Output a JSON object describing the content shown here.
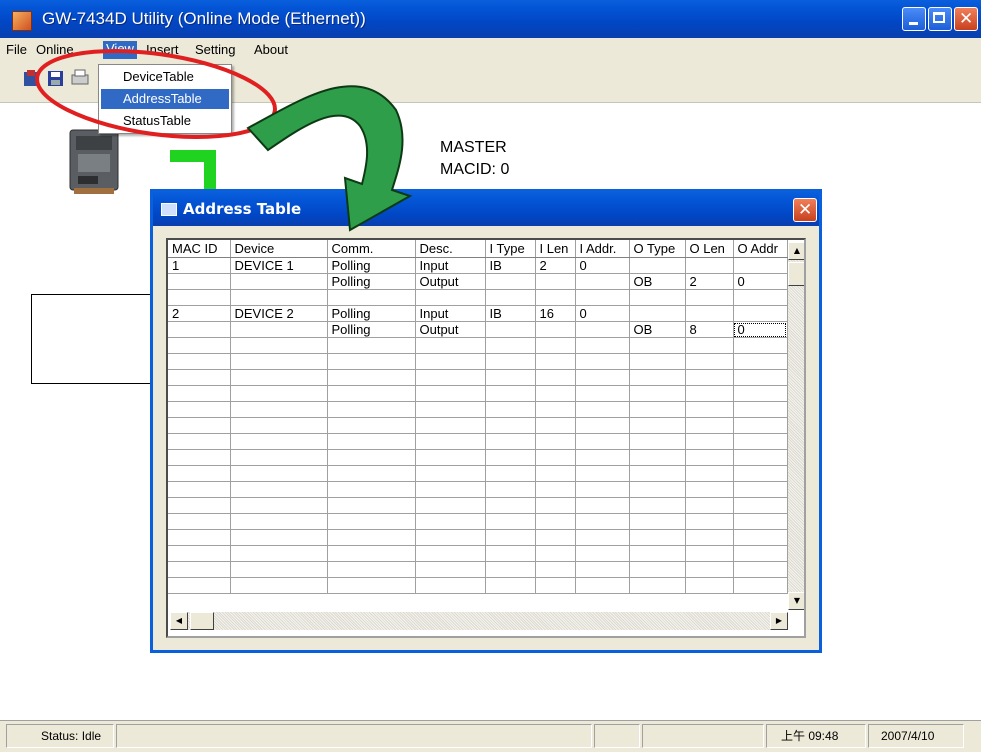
{
  "window": {
    "title": "GW-7434D Utility (Online Mode (Ethernet))"
  },
  "menubar": {
    "items": [
      "File",
      "Online",
      "View",
      "Insert",
      "Setting",
      "About"
    ]
  },
  "view_menu": {
    "items": [
      "DeviceTable",
      "AddressTable",
      "StatusTable"
    ],
    "selected": "AddressTable"
  },
  "canvas": {
    "master_label": "MASTER",
    "macid_label": "MACID:  0"
  },
  "address_table": {
    "title": "Address Table",
    "columns": [
      "MAC ID",
      "Device",
      "Comm.",
      "Desc.",
      "I Type",
      "I Len",
      "I Addr.",
      "O Type",
      "O Len",
      "O Addr"
    ],
    "rows": [
      [
        "1",
        "DEVICE 1",
        "Polling",
        "Input",
        "IB",
        "2",
        "0",
        "",
        "",
        ""
      ],
      [
        "",
        "",
        "Polling",
        "Output",
        "",
        "",
        "",
        "OB",
        "2",
        "0"
      ],
      [
        "",
        "",
        "",
        "",
        "",
        "",
        "",
        "",
        "",
        ""
      ],
      [
        "2",
        "DEVICE 2",
        "Polling",
        "Input",
        "IB",
        "16",
        "0",
        "",
        "",
        ""
      ],
      [
        "",
        "",
        "Polling",
        "Output",
        "",
        "",
        "",
        "OB",
        "8",
        "0"
      ]
    ],
    "empty_rows": 16
  },
  "statusbar": {
    "status": "Status: Idle",
    "time": "上午 09:48",
    "date": "2007/4/10"
  },
  "colors": {
    "titlebar": "#0355d6",
    "highlight": "#316ac5",
    "annotation_ellipse": "#e02020",
    "annotation_arrow": "#2f9e4a"
  }
}
